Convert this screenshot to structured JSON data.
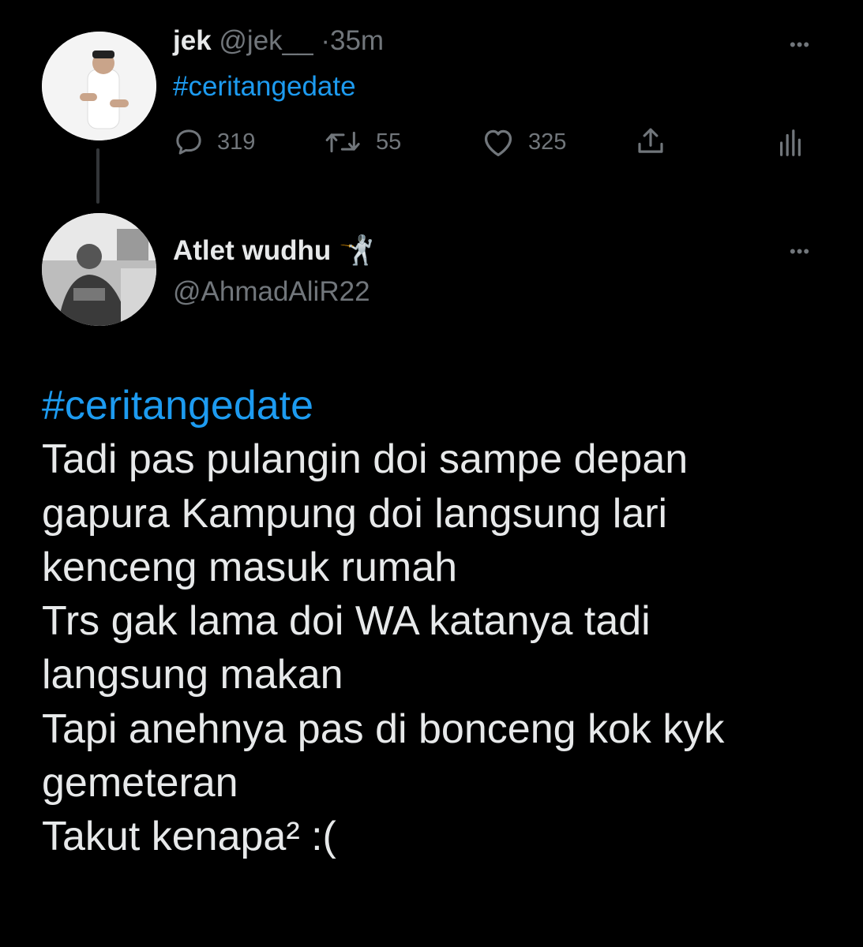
{
  "top_tweet": {
    "display_name": "jek",
    "handle": "@jek__",
    "separator": "·",
    "time": "35m",
    "text": "#ceritangedate",
    "stats": {
      "replies": "319",
      "retweets": "55",
      "likes": "325"
    },
    "more_glyph": "•••"
  },
  "reply_tweet": {
    "display_name": "Atlet wudhu",
    "name_emoji": "🤺",
    "handle": "@AhmadAliR22",
    "more_glyph": "•••",
    "hashtag": "#ceritangedate",
    "lines": [
      "Tadi pas pulangin doi sampe depan",
      "gapura Kampung doi langsung lari",
      "kenceng masuk rumah",
      "Trs gak lama doi WA katanya tadi",
      "langsung makan",
      "Tapi anehnya pas di bonceng kok kyk",
      "gemeteran",
      "Takut kenapa² :("
    ]
  },
  "colors": {
    "background": "#000000",
    "text": "#e7e9ea",
    "muted": "#71767b",
    "link": "#1d9bf0"
  },
  "icons": [
    "reply-icon",
    "retweet-icon",
    "like-icon",
    "share-icon",
    "analytics-icon",
    "more-icon"
  ]
}
